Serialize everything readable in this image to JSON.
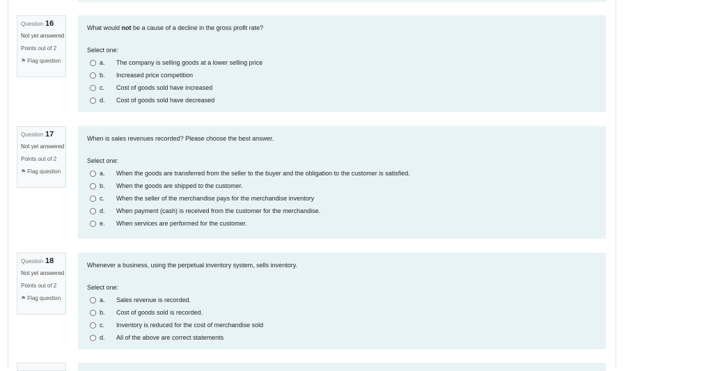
{
  "questions": [
    {
      "label": "Question",
      "number": "16",
      "state": "Not yet answered",
      "grade": "Points out of 2",
      "flag": "Flag question",
      "text_pre": "What would ",
      "text_bold": "not",
      "text_post": " be a cause of a decline in the gross profit rate?",
      "prompt": "Select one:",
      "options": [
        {
          "letter": "a.",
          "text": "The company is selling goods at a lower selling price"
        },
        {
          "letter": "b.",
          "text": "Increased price competition"
        },
        {
          "letter": "c.",
          "text": "Cost of goods sold have increased"
        },
        {
          "letter": "d.",
          "text": "Cost of goods sold have decreased"
        }
      ]
    },
    {
      "label": "Question",
      "number": "17",
      "state": "Not yet answered",
      "grade": "Points out of 2",
      "flag": "Flag question",
      "text_pre": "When is sales revenues recorded? Please choose the best answer.",
      "text_bold": "",
      "text_post": "",
      "prompt": "Select one:",
      "options": [
        {
          "letter": "a.",
          "text": "When the goods are transferred from the seller to the buyer and the obligation to the customer is satisfied."
        },
        {
          "letter": "b.",
          "text": "When the goods are shipped to the customer."
        },
        {
          "letter": "c.",
          "text": "When the seller of the merchandise pays for the merchandise inventory"
        },
        {
          "letter": "d.",
          "text": "When payment (cash) is received from the customer for the merchandise."
        },
        {
          "letter": "e.",
          "text": "When services are performed for the customer."
        }
      ]
    },
    {
      "label": "Question",
      "number": "18",
      "state": "Not yet answered",
      "grade": "Points out of 2",
      "flag": "Flag question",
      "text_pre": "Whenever a business, using the perpetual inventory system, sells inventory.",
      "text_bold": "",
      "text_post": "",
      "prompt": "Select one:",
      "options": [
        {
          "letter": "a.",
          "text": "Sales revenue is recorded."
        },
        {
          "letter": "b.",
          "text": "Cost of goods sold is recorded."
        },
        {
          "letter": "c.",
          "text": "Inventory is reduced for the cost of merchandise sold"
        },
        {
          "letter": "d.",
          "text": "All of the above are correct statements"
        }
      ]
    }
  ]
}
